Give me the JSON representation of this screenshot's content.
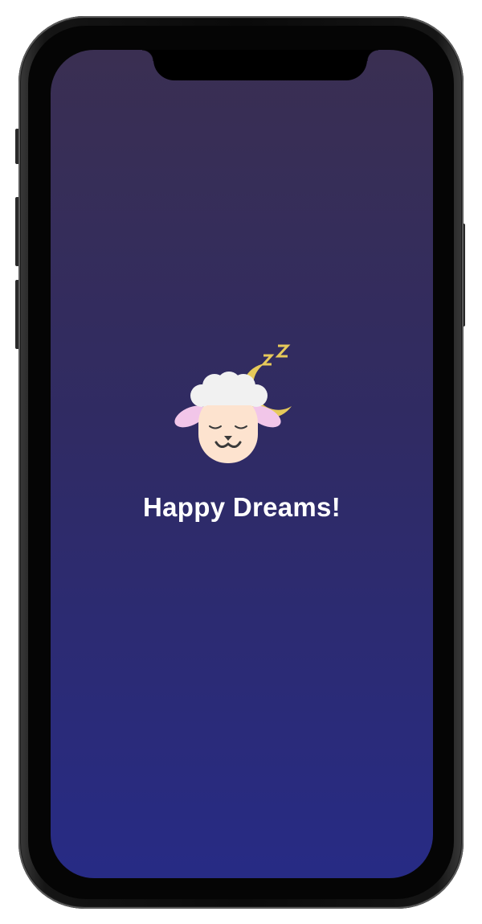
{
  "screen": {
    "title": "Happy Dreams!",
    "icon": "sleeping-sheep-icon",
    "background_top": "#3a2f52",
    "background_bottom": "#272b85"
  },
  "colors": {
    "moon": "#e6c95a",
    "zzz": "#e6c95a",
    "wool": "#f1f1f1",
    "face": "#fde3cf",
    "ears": "#f2c6e9",
    "title_text": "#ffffff"
  }
}
